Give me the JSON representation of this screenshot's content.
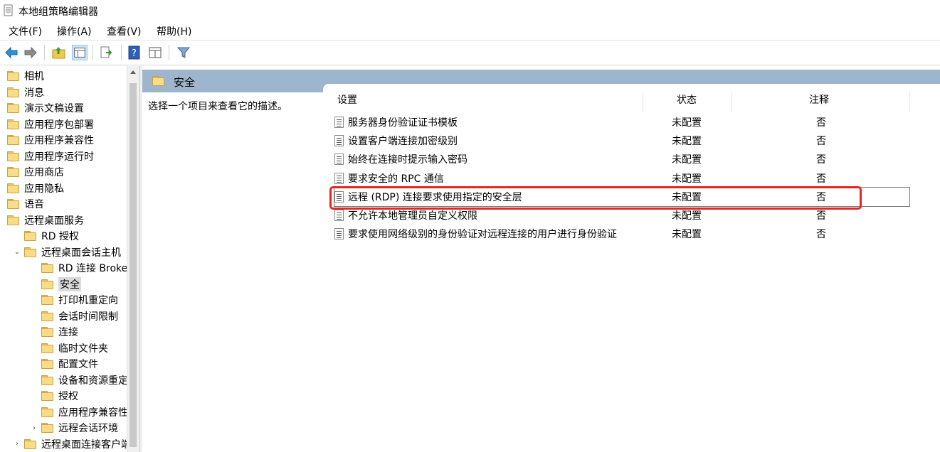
{
  "window": {
    "title": "本地组策略编辑器"
  },
  "menu": [
    "文件(F)",
    "操作(A)",
    "查看(V)",
    "帮助(H)"
  ],
  "toolbar": {
    "icons": [
      "back-arrow-icon",
      "forward-arrow-icon",
      "up-folder-icon",
      "show-hide-tree-icon",
      "export-list-icon",
      "help-icon",
      "properties-view-icon",
      "filter-icon"
    ]
  },
  "tree": {
    "items": [
      {
        "label": "相机",
        "level": 0,
        "expander": ""
      },
      {
        "label": "消息",
        "level": 0,
        "expander": ""
      },
      {
        "label": "演示文稿设置",
        "level": 0,
        "expander": ""
      },
      {
        "label": "应用程序包部署",
        "level": 0,
        "expander": ""
      },
      {
        "label": "应用程序兼容性",
        "level": 0,
        "expander": ""
      },
      {
        "label": "应用程序运行时",
        "level": 0,
        "expander": ""
      },
      {
        "label": "应用商店",
        "level": 0,
        "expander": ""
      },
      {
        "label": "应用隐私",
        "level": 0,
        "expander": ""
      },
      {
        "label": "语音",
        "level": 0,
        "expander": ""
      },
      {
        "label": "远程桌面服务",
        "level": 0,
        "expander": ""
      },
      {
        "label": "RD 授权",
        "level": 1,
        "expander": ""
      },
      {
        "label": "远程桌面会话主机",
        "level": 1,
        "expander": "⌄"
      },
      {
        "label": "RD 连接 Broker",
        "level": 2,
        "expander": ""
      },
      {
        "label": "安全",
        "level": 2,
        "expander": "",
        "selected": true
      },
      {
        "label": "打印机重定向",
        "level": 2,
        "expander": ""
      },
      {
        "label": "会话时间限制",
        "level": 2,
        "expander": ""
      },
      {
        "label": "连接",
        "level": 2,
        "expander": ""
      },
      {
        "label": "临时文件夹",
        "level": 2,
        "expander": ""
      },
      {
        "label": "配置文件",
        "level": 2,
        "expander": ""
      },
      {
        "label": "设备和资源重定向",
        "level": 2,
        "expander": ""
      },
      {
        "label": "授权",
        "level": 2,
        "expander": ""
      },
      {
        "label": "应用程序兼容性",
        "level": 2,
        "expander": ""
      },
      {
        "label": "远程会话环境",
        "level": 2,
        "expander": "›"
      },
      {
        "label": "远程桌面连接客户端",
        "level": 1,
        "expander": "›"
      }
    ]
  },
  "main": {
    "header_title": "安全",
    "description": "选择一个项目来查看它的描述。",
    "columns": [
      "设置",
      "状态",
      "注释"
    ],
    "rows": [
      {
        "name": "服务器身份验证证书模板",
        "state": "未配置",
        "comment": "否"
      },
      {
        "name": "设置客户端连接加密级别",
        "state": "未配置",
        "comment": "否"
      },
      {
        "name": "始终在连接时提示输入密码",
        "state": "未配置",
        "comment": "否"
      },
      {
        "name": "要求安全的 RPC 通信",
        "state": "未配置",
        "comment": "否"
      },
      {
        "name": "远程 (RDP) 连接要求使用指定的安全层",
        "state": "未配置",
        "comment": "否",
        "focused": true
      },
      {
        "name": "不允许本地管理员自定义权限",
        "state": "未配置",
        "comment": "否"
      },
      {
        "name": "要求使用网络级别的身份验证对远程连接的用户进行身份验证",
        "state": "未配置",
        "comment": "否"
      }
    ]
  },
  "colors": {
    "header_band": "#9db5cd",
    "highlight": "#e52521",
    "folder": "#f8dc8a"
  }
}
